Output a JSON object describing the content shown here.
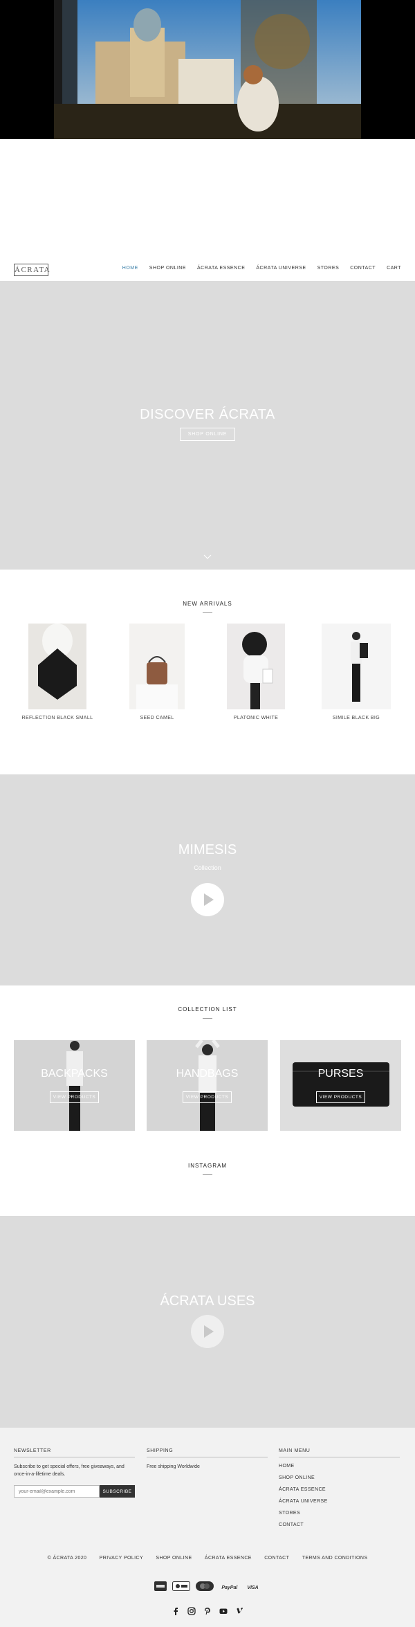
{
  "header": {
    "logo": "ÁCRATA",
    "nav": [
      "HOME",
      "SHOP ONLINE",
      "ÁCRATA ESSENCE",
      "ÁCRATA UNIVERSE",
      "STORES",
      "CONTACT",
      "CART"
    ]
  },
  "discover": {
    "title": "DISCOVER ÁCRATA",
    "button": "SHOP ONLINE"
  },
  "arrivals": {
    "title": "NEW ARRIVALS",
    "products": [
      "REFLECTION BLACK SMALL",
      "SEED CAMEL",
      "PLATONIC WHITE",
      "SIMILE BLACK BIG"
    ]
  },
  "mimesis": {
    "title": "MIMESIS",
    "subtitle": "Collection"
  },
  "collections": {
    "title": "COLLECTION LIST",
    "items": [
      {
        "title": "BACKPACKS",
        "button": "VIEW PRODUCTS"
      },
      {
        "title": "HANDBAGS",
        "button": "VIEW PRODUCTS"
      },
      {
        "title": "PURSES",
        "button": "VIEW PRODUCTS"
      }
    ]
  },
  "instagram": {
    "title": "INSTAGRAM"
  },
  "uses": {
    "title": "ÁCRATA USES"
  },
  "footer": {
    "newsletter": {
      "heading": "NEWSLETTER",
      "text": "Subscribe to get special offers, free giveaways, and once-in-a-lifetime deals.",
      "placeholder": "your-email@example.com",
      "button": "SUBSCRIBE"
    },
    "shipping": {
      "heading": "SHIPPING",
      "text": "Free shipping Worldwide"
    },
    "main_menu": {
      "heading": "MAIN MENU",
      "items": [
        "HOME",
        "SHOP ONLINE",
        "ÁCRATA ESSENCE",
        "ÁCRATA UNIVERSE",
        "STORES",
        "CONTACT"
      ]
    },
    "bottom_links": [
      "© ÁCRATA 2020",
      "PRIVACY POLICY",
      "SHOP ONLINE",
      "ÁCRATA ESSENCE",
      "CONTACT",
      "TERMS AND CONDITIONS"
    ],
    "payments": [
      "american-express-icon",
      "apple-pay-icon",
      "mastercard-icon",
      "PayPal",
      "VISA"
    ],
    "social": [
      "facebook-icon",
      "instagram-icon",
      "pinterest-icon",
      "youtube-icon",
      "vimeo-icon"
    ]
  },
  "colors": {
    "accent": "#3b7fa8",
    "section_gray": "#dcdcdc",
    "footer_bg": "#f2f2f2"
  }
}
